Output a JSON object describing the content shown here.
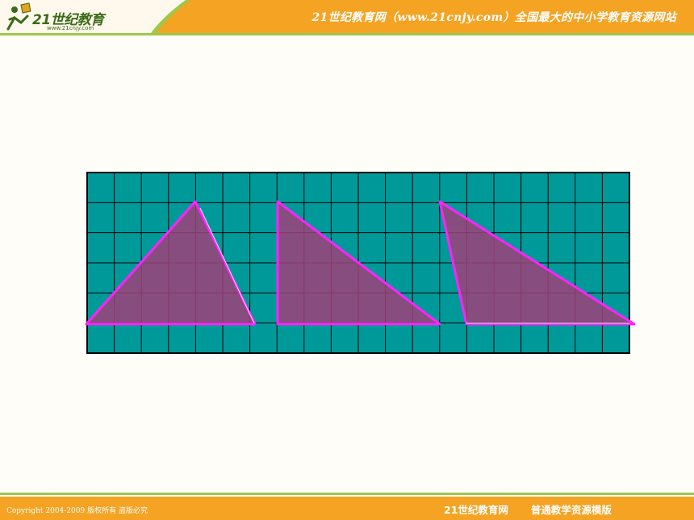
{
  "header": {
    "logo_text": "21世纪教育",
    "logo_url": "www.21cnjy.com",
    "site_title": "21世纪教育网（www.21cnjy.com）全国最大的中小学教育资源网站"
  },
  "figure": {
    "grid_fill": "#009999",
    "grid_line": "#000000",
    "triangle_stroke": "#ff22ff",
    "triangle_fill": "#a0407a",
    "triangles": [
      "acute-triangle",
      "right-triangle",
      "obtuse-triangle"
    ]
  },
  "footer": {
    "copyright": "Copyright 2004-2009 版权所有 盗版必究",
    "site_name": "21世纪教育网",
    "template_name": "普通教学资源模版"
  },
  "colors": {
    "header_bg": "#f4a323",
    "footer_bg": "#f4a323",
    "accent_green": "#9dc84a"
  }
}
